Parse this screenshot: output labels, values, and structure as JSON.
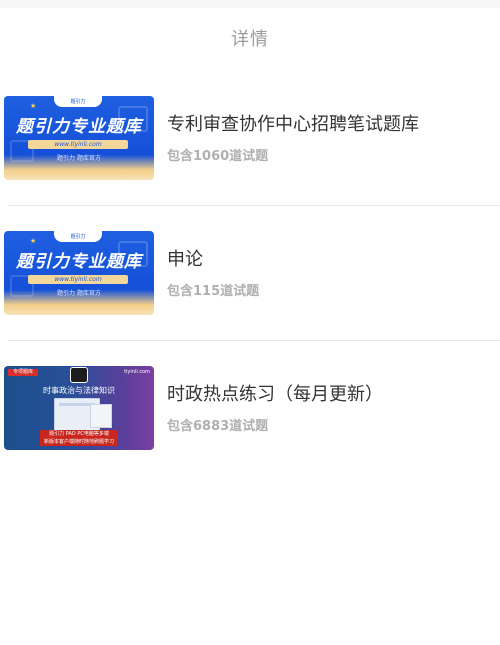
{
  "header": {
    "title": "详情"
  },
  "items": [
    {
      "name": "专利审查协作中心招聘笔试题库",
      "count": "包含1060道试题",
      "thumb": {
        "brand": "题引力",
        "headline": "题引力专业题库",
        "url": "www.tiyinli.com",
        "tagline": "题引力 题库官方"
      }
    },
    {
      "name": "申论",
      "count": "包含115道试题",
      "thumb": {
        "brand": "题引力",
        "headline": "题引力专业题库",
        "url": "www.tiyinli.com",
        "tagline": "题引力 题库官方"
      }
    },
    {
      "name": "时政热点练习（每月更新）",
      "count": "包含6883道试题",
      "thumb": {
        "tag": "专项题库",
        "site": "tiyinli.com",
        "heading": "时事政治与法律知识",
        "box_line1": "题引力 PAD PC电脑等多端",
        "box_line2": "新版本客户端随时随地刷题学习"
      }
    }
  ]
}
